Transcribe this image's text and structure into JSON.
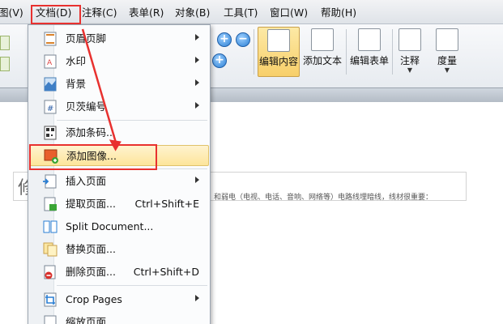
{
  "menubar": {
    "items": [
      "图(V)",
      "文档(D)",
      "注释(C)",
      "表单(R)",
      "对象(B)",
      "工具(T)",
      "窗口(W)",
      "帮助(H)"
    ]
  },
  "ribbon": {
    "buttons": [
      "编辑内容",
      "添加文本",
      "编辑表单",
      "注释",
      "度量"
    ]
  },
  "document_menu": {
    "items": [
      {
        "label": "页眉页脚",
        "submenu": true
      },
      {
        "label": "水印",
        "submenu": true
      },
      {
        "label": "背景",
        "submenu": true
      },
      {
        "label": "贝茨编号",
        "submenu": true
      },
      {
        "label": "添加条码..."
      },
      {
        "label": "添加图像..."
      },
      {
        "label": "插入页面",
        "submenu": true
      },
      {
        "label": "提取页面...",
        "shortcut": "Ctrl+Shift+E"
      },
      {
        "label": "Split Document..."
      },
      {
        "label": "替换页面..."
      },
      {
        "label": "删除页面...",
        "shortcut": "Ctrl+Shift+D"
      },
      {
        "label": "Crop Pages",
        "submenu": true
      },
      {
        "label": "缩放页面"
      }
    ]
  },
  "document": {
    "big_char": "修",
    "line_text": "和弱电（电视、电话、音响、网络等）电路线埋暗线，线材很重要："
  },
  "colors": {
    "highlight": "#e8312f",
    "hover": "#fde59b"
  }
}
